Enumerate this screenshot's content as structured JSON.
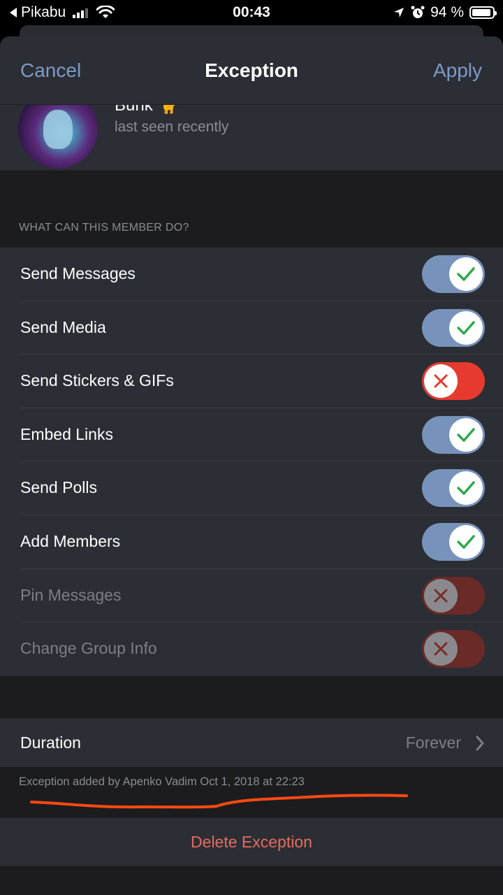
{
  "status_bar": {
    "carrier": "Pikabu",
    "time": "00:43",
    "battery": "94 %",
    "battery_level": 0.94
  },
  "nav": {
    "cancel_label": "Cancel",
    "title": "Exception",
    "apply_label": "Apply"
  },
  "member": {
    "name": "Bunk 🐈",
    "status": "last seen recently"
  },
  "permissions": {
    "section_header": "WHAT CAN THIS MEMBER DO?",
    "items": [
      {
        "label": "Send Messages",
        "state": "on",
        "enabled": true
      },
      {
        "label": "Send Media",
        "state": "on",
        "enabled": true
      },
      {
        "label": "Send Stickers & GIFs",
        "state": "off",
        "enabled": true
      },
      {
        "label": "Embed Links",
        "state": "on",
        "enabled": true
      },
      {
        "label": "Send Polls",
        "state": "on",
        "enabled": true
      },
      {
        "label": "Add Members",
        "state": "on",
        "enabled": true
      },
      {
        "label": "Pin Messages",
        "state": "off",
        "enabled": false
      },
      {
        "label": "Change Group Info",
        "state": "off",
        "enabled": false
      }
    ]
  },
  "duration": {
    "label": "Duration",
    "value": "Forever"
  },
  "footer_note": "Exception added by Apenko Vadim Oct 1, 2018 at 22:23",
  "delete_label": "Delete Exception",
  "colors": {
    "accent": "#7e9bc7",
    "toggle_on": "#7893bb",
    "toggle_off": "#e63a2f",
    "check": "#2fa84a",
    "cross": "#e63a2f",
    "destructive": "#e76b5f",
    "scribble": "#ff4a10"
  }
}
